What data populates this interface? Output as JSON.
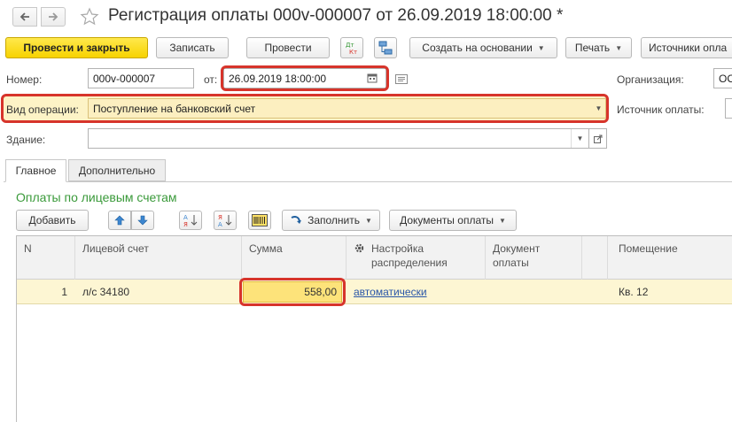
{
  "window": {
    "title": "Регистрация оплаты 000v-000007 от 26.09.2019 18:00:00 *"
  },
  "toolbar": {
    "post_close": "Провести и закрыть",
    "write": "Записать",
    "post": "Провести",
    "create_based": "Создать на основании",
    "print": "Печать",
    "sources": "Источники опла"
  },
  "form": {
    "number_label": "Номер:",
    "number_value": "000v-000007",
    "date_label": "от:",
    "date_value": "26.09.2019 18:00:00",
    "org_label": "Организация:",
    "org_value": "ОО",
    "op_label": "Вид операции:",
    "op_value": "Поступление на банковский счет",
    "source_label": "Источник оплаты:",
    "building_label": "Здание:",
    "building_value": ""
  },
  "tabs": [
    {
      "label": "Главное",
      "active": true
    },
    {
      "label": "Дополнительно",
      "active": false
    }
  ],
  "section": {
    "title": "Оплаты по лицевым счетам",
    "add": "Добавить",
    "fill": "Заполнить",
    "pay_docs": "Документы оплаты"
  },
  "table": {
    "headers": {
      "n": "N",
      "account": "Лицевой счет",
      "sum": "Сумма",
      "dist_1": "Настройка",
      "dist_2": "распределения",
      "doc_1": "Документ",
      "doc_2": "оплаты",
      "room": "Помещение"
    },
    "rows": [
      {
        "n": "1",
        "account": "л/с 34180",
        "sum": "558,00",
        "dist": "автоматически",
        "doc": "",
        "room": "Кв. 12"
      }
    ]
  },
  "colors": {
    "accent_yellow": "#f7d300",
    "highlight_red": "#d7342b",
    "section_green": "#3a9a3a",
    "selected_row": "#fdf6d3"
  }
}
